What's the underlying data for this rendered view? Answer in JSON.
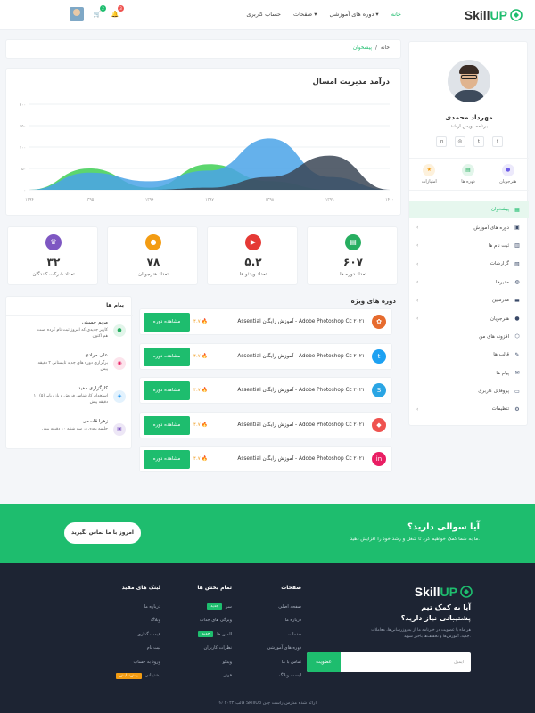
{
  "header": {
    "brand": {
      "a": "Skill",
      "b": "UP"
    },
    "nav": [
      "خانه",
      "دوره های آموزشی",
      "صفحات",
      "حساب کاربری"
    ],
    "icons": [
      {
        "name": "cart-icon",
        "glyph": "🛒",
        "badge": "2",
        "color": "#1ebd6e"
      },
      {
        "name": "bell-icon",
        "glyph": "🔔",
        "badge": "3",
        "color": "#ef5350"
      }
    ]
  },
  "sidebar": {
    "name": "مهرداد محمدی",
    "role": "برنامه نویس ارشد",
    "socials": [
      "f",
      "t",
      "ig",
      "in"
    ],
    "stats": [
      {
        "label": "امتیازات",
        "glyph": "★",
        "color": "#f39c12",
        "bg": "#fdf1dc"
      },
      {
        "label": "دوره ها",
        "glyph": "▤",
        "color": "#27ae60",
        "bg": "#e2f5ea"
      },
      {
        "label": "هنرجویان",
        "glyph": "●",
        "color": "#6c5ce7",
        "bg": "#ece9fb"
      }
    ],
    "menu": [
      {
        "label": "پیشخوان",
        "glyph": "▦",
        "active": true,
        "chev": false
      },
      {
        "label": "دوره های آموزش",
        "glyph": "▣",
        "chev": true
      },
      {
        "label": "ثبت نام ها",
        "glyph": "▥",
        "chev": true
      },
      {
        "label": "گزارشات",
        "glyph": "▧",
        "chev": true
      },
      {
        "label": "مدیرها",
        "glyph": "◍",
        "chev": true
      },
      {
        "label": "مدرسین",
        "glyph": "▬",
        "chev": true
      },
      {
        "label": "هنرجویان",
        "glyph": "●",
        "chev": true
      },
      {
        "label": "افزونه های من",
        "glyph": "⬡",
        "chev": false
      },
      {
        "label": "قالب ها",
        "glyph": "✎",
        "chev": false
      },
      {
        "label": "پیام ها",
        "glyph": "✉",
        "chev": false
      },
      {
        "label": "پروفایل کاربری",
        "glyph": "▭",
        "chev": false
      },
      {
        "label": "تنظیمات",
        "glyph": "⚙",
        "chev": true
      }
    ]
  },
  "breadcrumb": {
    "home": "خانه",
    "sep": "/",
    "current": "پیشخوان"
  },
  "chart_data": {
    "type": "area",
    "title": "درآمد مدیریت امسال",
    "x": [
      "۱۳۹۴",
      "۱۳۹۵",
      "۱۳۹۶",
      "۱۳۹۷",
      "۱۳۹۸",
      "۱۳۹۹",
      "۱۴۰۰"
    ],
    "yticks": [
      "۰",
      "۵۰",
      "۱۰۰",
      "۱۵۰",
      "۲۰۰"
    ],
    "ylim": [
      0,
      200
    ],
    "series": [
      {
        "color": "#3fcf55",
        "values": [
          0,
          50,
          5,
          60,
          20,
          0,
          0
        ]
      },
      {
        "color": "#4aa3e8",
        "values": [
          0,
          40,
          20,
          45,
          120,
          30,
          0
        ]
      },
      {
        "color": "#3b4656",
        "values": [
          0,
          0,
          0,
          5,
          30,
          80,
          0
        ]
      }
    ]
  },
  "stat_cards": [
    {
      "value": "۶۰۷",
      "label": "تعداد دوره ها",
      "glyph": "▤",
      "color": "#27ae60"
    },
    {
      "value": "۵.۲",
      "label": "تعداد ویدئو ها",
      "glyph": "▶",
      "color": "#e53935"
    },
    {
      "value": "۷۸",
      "label": "تعداد هنرجویان",
      "glyph": "●",
      "color": "#f39c12"
    },
    {
      "value": "۳۲",
      "label": "تعداد شرکت کنندگان",
      "glyph": "♛",
      "color": "#7e57c2"
    }
  ],
  "featured": {
    "title": "دوره های ویژه",
    "button": "مشاهده دوره",
    "items": [
      {
        "name": "Adobe Photoshop Cc ۲۰۲۱ - آموزش رایگان Assential",
        "rating": "۴.۷",
        "icon": "✿",
        "color": "#e66b2e"
      },
      {
        "name": "Adobe Photoshop Cc ۲۰۲۱ - آموزش رایگان Assential",
        "rating": "۴.۷",
        "icon": "t",
        "color": "#1da1f2"
      },
      {
        "name": "Adobe Photoshop Cc ۲۰۲۱ - آموزش رایگان Assential",
        "rating": "۴.۷",
        "icon": "S",
        "color": "#2aa5e4"
      },
      {
        "name": "Adobe Photoshop Cc ۲۰۲۱ - آموزش رایگان Assential",
        "rating": "۴.۷",
        "icon": "◆",
        "color": "#ef5350"
      },
      {
        "name": "Adobe Photoshop Cc ۲۰۲۱ - آموزش رایگان Assential",
        "rating": "۴.۷",
        "icon": "in",
        "color": "#e91e63"
      }
    ]
  },
  "messages": {
    "title": "پیام ها",
    "items": [
      {
        "name": "مریم حسینی",
        "text": "کاربر جدیدی که امروز ثبت نام کرده است هم اکنون",
        "glyph": "●",
        "color": "#27ae60",
        "bg": "#e2f5ea"
      },
      {
        "name": "علی مرادی",
        "text": "برگزاری دوره های جدید تابستانی ۲ دقیقه پیش",
        "glyph": "◉",
        "color": "#e91e63",
        "bg": "#fce4ec"
      },
      {
        "name": "کارگزاری مفید",
        "text": "استخدام کارشناس فروش و بازاریابی(۵) ۱۰ دقیقه پیش",
        "glyph": "◈",
        "color": "#2196f3",
        "bg": "#e3f2fd"
      },
      {
        "name": "زهرا قاسمی",
        "text": "جلسه بعدی در سه شنبه ۱۰ دقیقه پیش",
        "glyph": "▣",
        "color": "#7e57c2",
        "bg": "#ede7f6"
      }
    ]
  },
  "cta": {
    "title": "آیا سوالی دارید؟",
    "subtitle": "ما به شما کمک خواهیم کرد تا شغل و رشد خود را افزایش دهید.",
    "button": "امروز با ما تماس بگیرید"
  },
  "footer": {
    "headline": "آیا به کمک تیم پشتیبانی نیاز دارید؟",
    "desc": "هر ماه با عضویت در خبرنامه ما از به‌روزرسانی‌ها، معاملات جدید، آموزش‌ها و تخفیف‌ها باخبر شوید.",
    "subscribe_btn": "عضویت",
    "email_placeholder": "ایمیل",
    "cols": [
      {
        "title": "صفحات",
        "links": [
          {
            "t": "صفحه اصلی"
          },
          {
            "t": "درباره ما"
          },
          {
            "t": "خدمات"
          },
          {
            "t": "دوره های آموزشی"
          },
          {
            "t": "تماس با ما"
          },
          {
            "t": "لیست وبلاگ"
          }
        ]
      },
      {
        "title": "تمام بخش ها",
        "links": [
          {
            "t": "سر",
            "tag": "جدید",
            "tagc": "#1ebd6e"
          },
          {
            "t": "ویژگی های جذاب"
          },
          {
            "t": "المان ها",
            "tag": "جدید",
            "tagc": "#1ebd6e"
          },
          {
            "t": "نظرات کاربران"
          },
          {
            "t": "ویدئو"
          },
          {
            "t": "فوتر"
          }
        ]
      },
      {
        "title": "لینک های مفید",
        "links": [
          {
            "t": "درباره ما"
          },
          {
            "t": "وبلاگ"
          },
          {
            "t": "قیمت گذاری"
          },
          {
            "t": "ثبت نام"
          },
          {
            "t": "ورود به حساب"
          },
          {
            "t": "پشتیبانی",
            "tag": "پیش‌نمایش",
            "tagc": "#f39c12"
          }
        ]
      }
    ],
    "copyright": "© ۲۰۲۲ قالب SkillUp ارائه شده مدرس راست چین"
  }
}
